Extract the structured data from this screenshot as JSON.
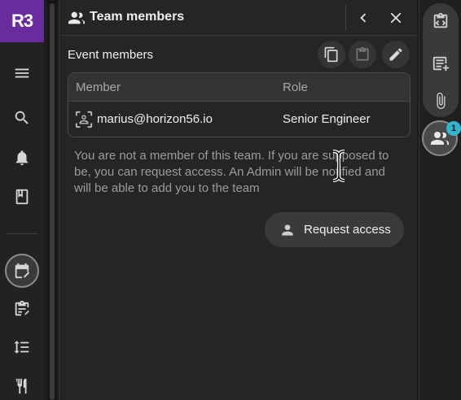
{
  "app": {
    "logo_text": "R3",
    "brand_color": "#6a2c9c"
  },
  "left_rail": {
    "items": [
      {
        "name": "menu-icon"
      },
      {
        "name": "search-icon"
      },
      {
        "name": "bell-icon"
      },
      {
        "name": "book-icon"
      },
      {
        "name": "calendar-edit-icon",
        "active": true
      },
      {
        "name": "clipboard-edit-icon"
      },
      {
        "name": "sort-lines-icon"
      },
      {
        "name": "fork-knife-icon"
      }
    ]
  },
  "panel": {
    "title": "Team members",
    "section_title": "Event members",
    "table": {
      "headers": {
        "member": "Member",
        "role": "Role"
      },
      "rows": [
        {
          "member": "marius@horizon56.io",
          "role": "Senior Engineer"
        }
      ]
    },
    "notice": "You are not a member of this team. If you are supposed to be, you can request access. An Admin will be notified and will be able to add you to the team",
    "request_button": "Request access"
  },
  "right_rail": {
    "items": [
      {
        "name": "code-doc-icon"
      },
      {
        "name": "add-note-icon"
      },
      {
        "name": "attachment-icon"
      }
    ],
    "team_badge_count": "1",
    "badge_color": "#36b3cc"
  }
}
